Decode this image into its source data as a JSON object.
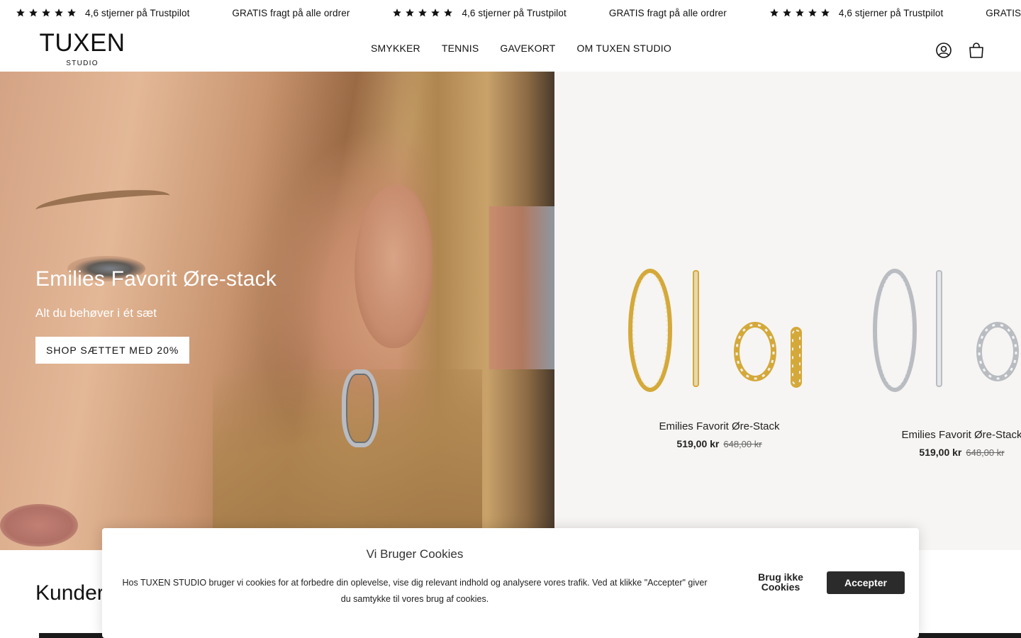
{
  "announcement": {
    "items": [
      {
        "type": "rating",
        "text": "4,6 stjerner på Trustpilot"
      },
      {
        "type": "text",
        "text": "GRATIS fragt på alle ordrer"
      },
      {
        "type": "rating",
        "text": "4,6 stjerner på Trustpilot"
      },
      {
        "type": "text",
        "text": "GRATIS fragt på alle ordrer"
      },
      {
        "type": "rating",
        "text": "4,6 stjerner på Trustpilot"
      },
      {
        "type": "text",
        "text": "GRATIS"
      }
    ],
    "star_count": 5
  },
  "header": {
    "logo_main": "TUXEN",
    "logo_sub": "STUDIO",
    "nav": [
      "SMYKKER",
      "TENNIS",
      "GAVEKORT",
      "OM TUXEN STUDIO"
    ],
    "icons": [
      "account-icon",
      "cart-icon"
    ]
  },
  "hero": {
    "title": "Emilies Favorit Øre-stack",
    "subtitle": "Alt du behøver i ét sæt",
    "cta": "SHOP SÆTTET MED 20%"
  },
  "products": [
    {
      "name": "Emilies Favorit Øre-Stack",
      "price": "519,00 kr",
      "old_price": "648,00 kr",
      "metal": "gold"
    },
    {
      "name": "Emilies Favorit Øre-Stack",
      "price": "519,00 kr",
      "old_price": "648,00 kr",
      "metal": "silver"
    }
  ],
  "section": {
    "title": "Kunder"
  },
  "cookie": {
    "title": "Vi Bruger Cookies",
    "body": "Hos TUXEN STUDIO bruger vi cookies for at forbedre din oplevelse, vise dig relevant indhold og analysere vores trafik. Ved at klikke \"Accepter\" giver du samtykke til vores brug af cookies.",
    "decline": "Brug ikke Cookies",
    "accept": "Accepter"
  },
  "colors": {
    "text": "#111111",
    "accept_button": "#2b2b2b",
    "product_bg": "#f6f5f3",
    "gold": "#d4a93a",
    "silver": "#b9bcc1"
  }
}
